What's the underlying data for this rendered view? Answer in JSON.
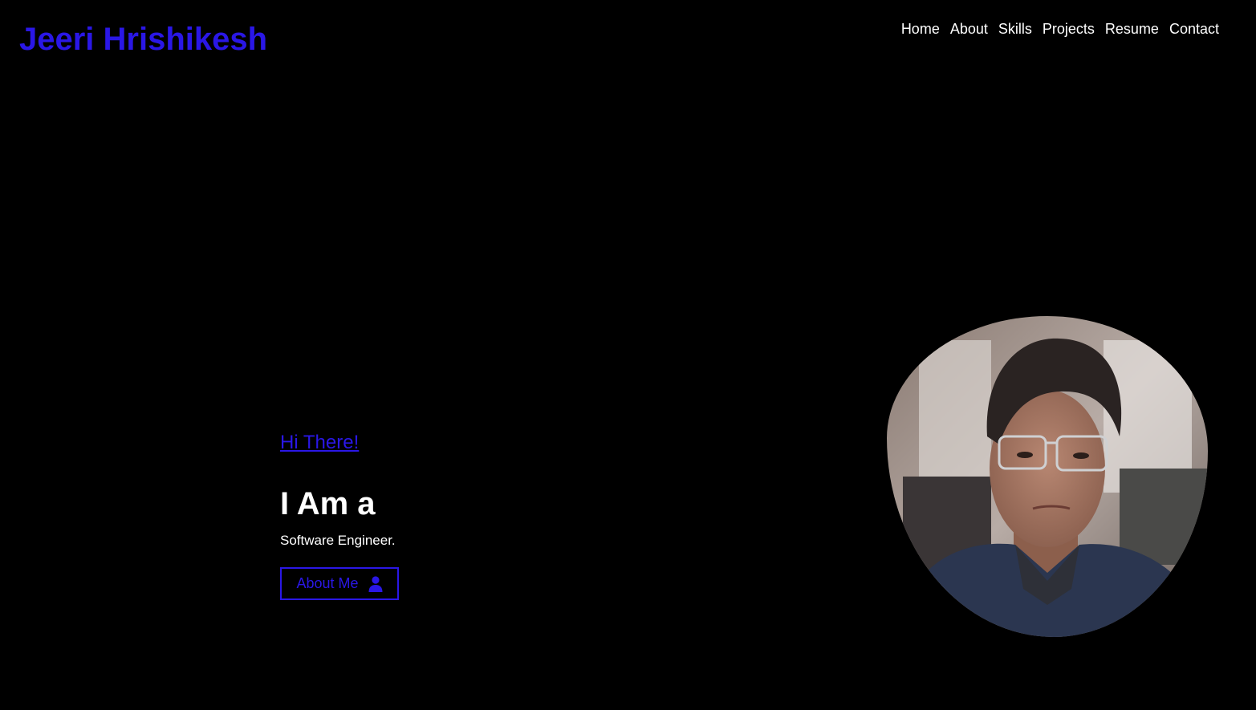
{
  "header": {
    "brand": "Jeeri Hrishikesh",
    "nav": [
      "Home",
      "About",
      "Skills",
      "Projects",
      "Resume",
      "Contact"
    ]
  },
  "hero": {
    "greeting": "Hi There!",
    "headline": "I Am a",
    "role": "Software Engineer.",
    "cta_label": "About Me",
    "cta_icon": "user-icon"
  },
  "colors": {
    "accent": "#2a17e6",
    "background": "#000000",
    "text": "#ffffff"
  }
}
